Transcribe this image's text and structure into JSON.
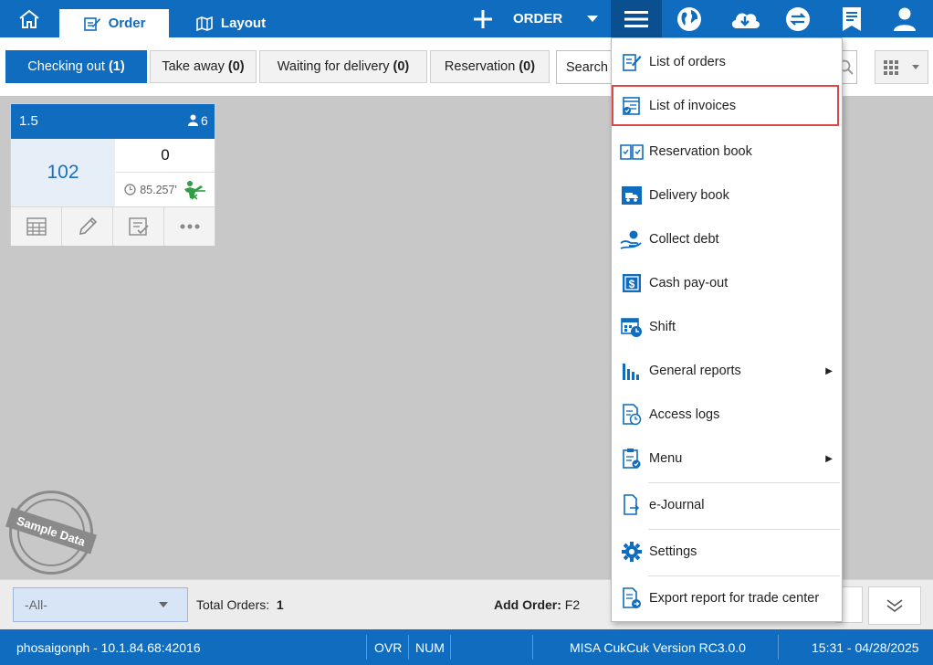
{
  "top_bar": {
    "tabs": [
      {
        "label": "Order",
        "icon": "edit-icon"
      },
      {
        "label": "Layout",
        "icon": "map-icon"
      }
    ],
    "order_button": "ORDER"
  },
  "filter_tabs": [
    {
      "label": "Checking out",
      "count": "(1)"
    },
    {
      "label": "Take away",
      "count": "(0)"
    },
    {
      "label": "Waiting for delivery",
      "count": "(0)"
    },
    {
      "label": "Reservation",
      "count": "(0)"
    }
  ],
  "search": {
    "value": "Search"
  },
  "order_card": {
    "table": "1.5",
    "guests": "6",
    "order_no": "102",
    "amount": "0",
    "time": "85.257'"
  },
  "watermark": "Sample Data",
  "footer": {
    "filter_value": "-All-",
    "total_label": "Total Orders:",
    "total_value": "1",
    "add_order_label": "Add Order:",
    "add_order_key": "F2"
  },
  "status_bar": {
    "server": "phosaigonph - 10.1.84.68:42016",
    "ovr": "OVR",
    "num": "NUM",
    "version": "MISA CukCuk Version RC3.0.0",
    "datetime": "15:31 - 04/28/2025"
  },
  "menu": {
    "items": [
      {
        "label": "List of orders",
        "icon": "list-orders-icon"
      },
      {
        "label": "List of invoices",
        "icon": "invoice-icon"
      },
      {
        "label": "Reservation book",
        "icon": "book-icon"
      },
      {
        "label": "Delivery book",
        "icon": "delivery-icon"
      },
      {
        "label": "Collect debt",
        "icon": "coins-icon"
      },
      {
        "label": "Cash pay-out",
        "icon": "cash-icon"
      },
      {
        "label": "Shift",
        "icon": "calendar-icon"
      },
      {
        "label": "General reports",
        "icon": "bar-chart-icon"
      },
      {
        "label": "Access logs",
        "icon": "log-icon"
      },
      {
        "label": "Menu",
        "icon": "clipboard-icon"
      },
      {
        "label": "e-Journal",
        "icon": "journal-icon"
      },
      {
        "label": "Settings",
        "icon": "gear-icon"
      },
      {
        "label": "Export report for trade center",
        "icon": "export-icon"
      }
    ]
  },
  "colors": {
    "primary": "#0f6cbf",
    "highlight": "#e04848"
  }
}
